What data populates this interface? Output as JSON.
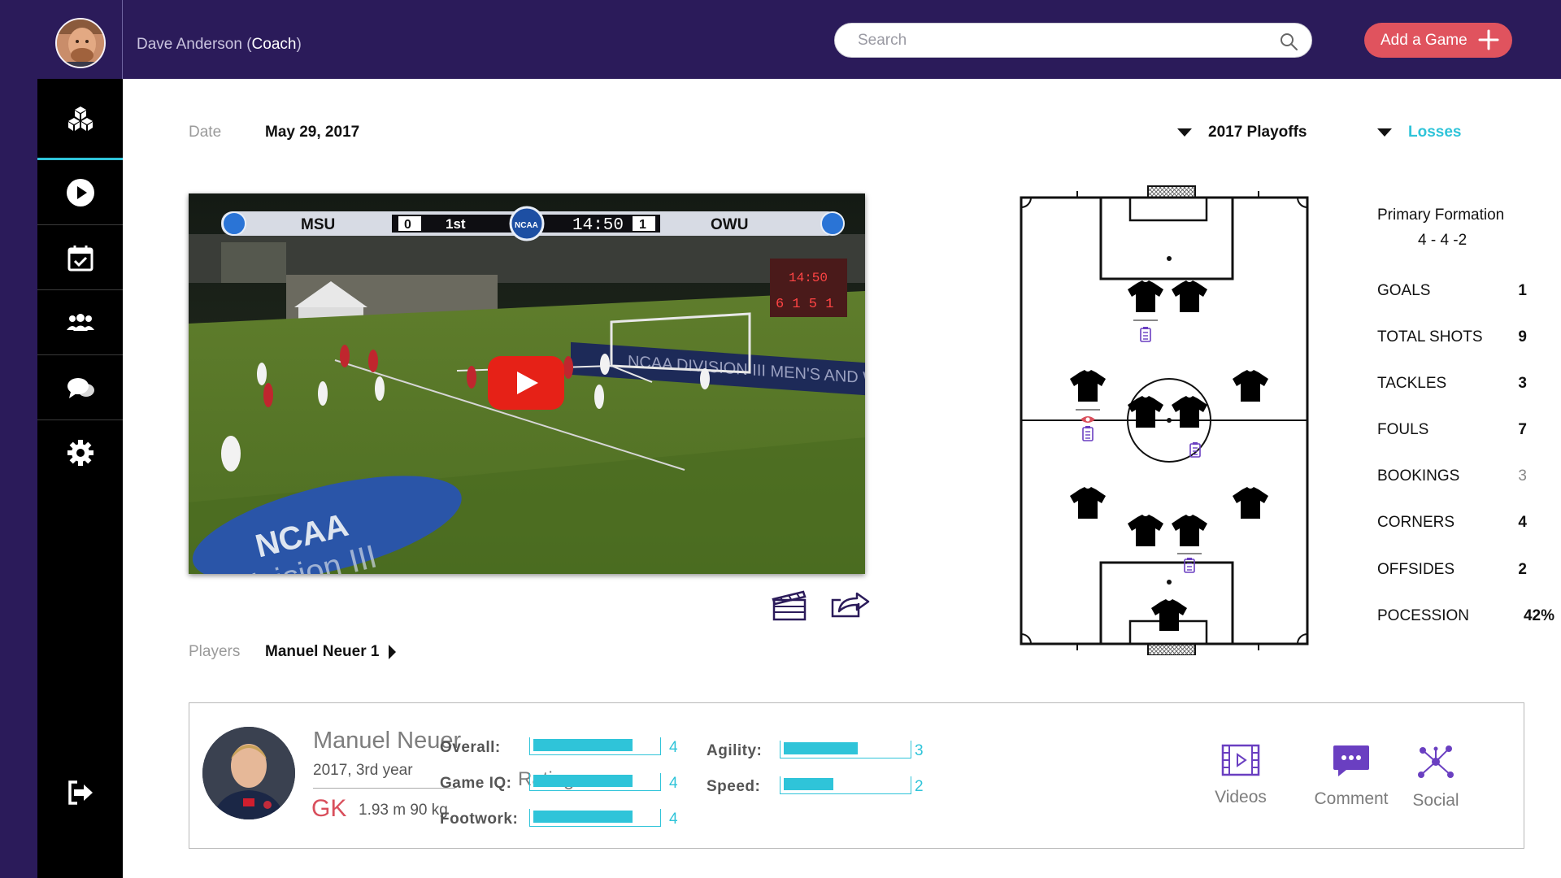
{
  "header": {
    "user_name": "Dave Anderson",
    "user_role_open": " (",
    "user_role": "Coach",
    "user_role_close": ")",
    "search_placeholder": "Search",
    "add_game_label": "Add a Game"
  },
  "sidebar": {
    "items": [
      {
        "icon": "cubes-icon",
        "active": true
      },
      {
        "icon": "play-circle-icon",
        "active": false
      },
      {
        "icon": "calendar-check-icon",
        "active": false
      },
      {
        "icon": "team-icon",
        "active": false
      },
      {
        "icon": "chat-bubbles-icon",
        "active": false
      },
      {
        "icon": "gear-icon",
        "active": false
      }
    ],
    "logout_icon": "logout-icon"
  },
  "meta": {
    "date_label": "Date",
    "date_value": "May 29, 2017",
    "season": "2017 Playoffs",
    "filter": "Losses",
    "filter_color": "#2fc4d9",
    "players_label": "Players",
    "players_value": "Manuel Neuer 1"
  },
  "video": {
    "home_team": "MSU",
    "home_score": "0",
    "period": "1st",
    "clock": "14:50",
    "away_score": "1",
    "away_team": "OWU",
    "badge": "NCAA",
    "banner_text": "NCAA DIVISION III MEN'S AND WOMEN'S",
    "ground_logo": "NCAA",
    "ground_text": "Division III",
    "scoreboard_top": "14:50",
    "scoreboard_nums": "6 1 5 1"
  },
  "stats": {
    "formation_label": "Primary Formation",
    "formation_value": "4 - 4 -2",
    "rows": [
      {
        "label": "GOALS",
        "value": "1",
        "muted": false
      },
      {
        "label": "TOTAL SHOTS",
        "value": "9",
        "muted": false
      },
      {
        "label": "TACKLES",
        "value": "3",
        "muted": false
      },
      {
        "label": "FOULS",
        "value": "7",
        "muted": false
      },
      {
        "label": "BOOKINGS",
        "value": "3",
        "muted": true
      },
      {
        "label": "CORNERS",
        "value": "4",
        "muted": false
      },
      {
        "label": "OFFSIDES",
        "value": "2",
        "muted": false
      },
      {
        "label": "POCESSION",
        "value": "42%",
        "muted": false
      }
    ]
  },
  "player": {
    "name": "Manuel Neuer",
    "year": "2017, 3rd year",
    "position": "GK",
    "physical": "1.93 m 90 kg",
    "ratings_label": "Ratings:",
    "ratings": [
      {
        "label": "Overall:",
        "value": "4",
        "fraction": 0.8
      },
      {
        "label": "Game IQ:",
        "value": "4",
        "fraction": 0.8
      },
      {
        "label": "Footwork:",
        "value": "4",
        "fraction": 0.8
      },
      {
        "label": "Agility:",
        "value": "3",
        "fraction": 0.6
      },
      {
        "label": "Speed:",
        "value": "2",
        "fraction": 0.4
      }
    ],
    "actions": [
      {
        "label": "Videos",
        "icon": "film-strip-icon"
      },
      {
        "label": "Comment",
        "icon": "comment-icon"
      },
      {
        "label": "Social",
        "icon": "network-icon"
      }
    ],
    "accent": "#6a3fc1"
  }
}
